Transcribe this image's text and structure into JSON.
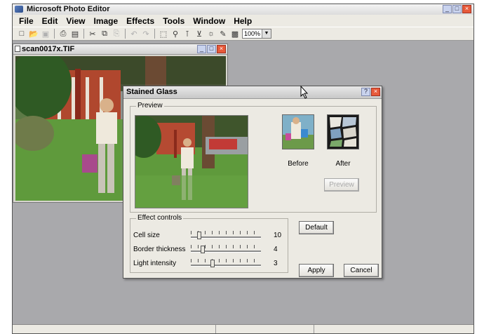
{
  "app": {
    "title": "Microsoft Photo Editor",
    "window_buttons": [
      "_",
      "□",
      "×"
    ]
  },
  "menu": [
    "File",
    "Edit",
    "View",
    "Image",
    "Effects",
    "Tools",
    "Window",
    "Help"
  ],
  "toolbar": {
    "icons": [
      "new-icon",
      "open-icon",
      "save-icon",
      "print-icon",
      "scan-icon",
      "cut-icon",
      "copy-icon",
      "paste-icon",
      "undo-icon",
      "redo-icon",
      "select-icon",
      "zoom-icon",
      "smart-select-icon",
      "crop-icon",
      "effects-icon",
      "pen-icon",
      "edit-icon"
    ],
    "zoom_value": "100%"
  },
  "image_window": {
    "title": "scan0017x.TIF"
  },
  "dialog": {
    "title": "Stained Glass",
    "preview_group": "Preview",
    "before_label": "Before",
    "after_label": "After",
    "preview_button": "Preview",
    "effect_group": "Effect controls",
    "controls": [
      {
        "label": "Cell size",
        "value": "10",
        "level": 0.1
      },
      {
        "label": "Border thickness",
        "value": "4",
        "level": 0.15
      },
      {
        "label": "Light intensity",
        "value": "3",
        "level": 0.3
      }
    ],
    "default_button": "Default",
    "apply_button": "Apply",
    "cancel_button": "Cancel"
  }
}
